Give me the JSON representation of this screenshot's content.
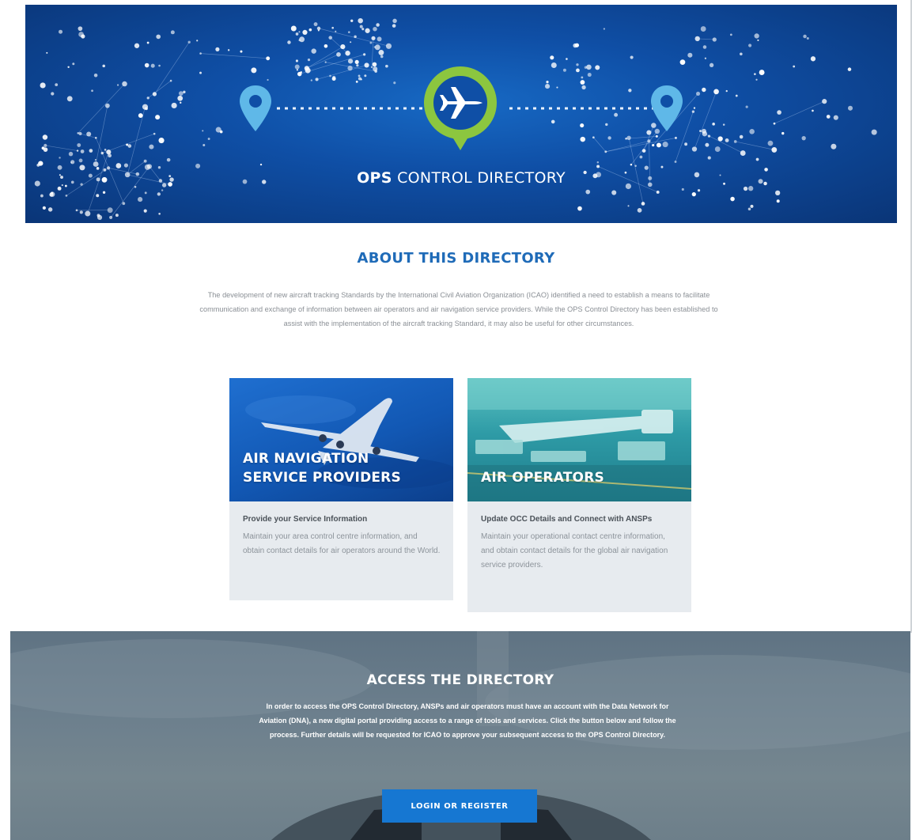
{
  "hero": {
    "title_bold": "OPS",
    "title_rest": " CONTROL DIRECTORY"
  },
  "about": {
    "title": "ABOUT THIS DIRECTORY",
    "text": "The development of new aircraft tracking Standards by the International Civil Aviation Organization (ICAO) identified a need to establish a means to facilitate communication and exchange of information between air operators and air navigation service providers. While the OPS Control Directory has been established to assist with the implementation of the aircraft tracking Standard, it may also be useful for other circumstances."
  },
  "cards": [
    {
      "title_line1": "AIR NAVIGATION",
      "title_line2": "SERVICE PROVIDERS",
      "subtitle": "Provide your Service Information",
      "description": "Maintain your area control centre information, and obtain contact details for air operators around the World."
    },
    {
      "title_line1": "AIR OPERATORS",
      "subtitle": "Update OCC Details and Connect with ANSPs",
      "description": "Maintain your operational contact centre information, and obtain contact details for the global air navigation service providers."
    }
  ],
  "access": {
    "title": "ACCESS THE DIRECTORY",
    "text": "In order to access the OPS Control Directory, ANSPs and air operators must have an account with the Data Network for Aviation (DNA), a new digital portal providing access to a range of tools and services. Click the button below and follow the process. Further details will be requested for ICAO to approve your subsequent access to the OPS Control Directory.",
    "button_label": "LOGIN OR REGISTER"
  },
  "colors": {
    "accent_blue": "#1f6bb8",
    "button_blue": "#1677d2",
    "pin_green": "#8cc63f",
    "pin_blue": "#5fb8e8"
  },
  "icons": [
    "map-pin-icon",
    "airplane-icon"
  ]
}
